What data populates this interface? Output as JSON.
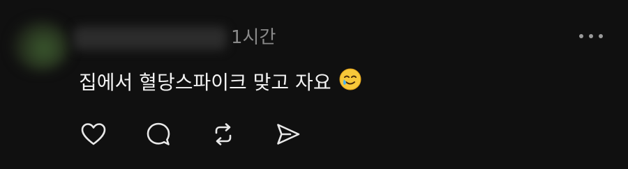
{
  "post": {
    "timestamp": "1시간",
    "text": "집에서 혈당스파이크 맞고 자요",
    "emoji": "smiling-face-with-tear"
  },
  "icons": {
    "more": "more-horizontal-icon",
    "like": "heart-icon",
    "reply": "comment-bubble-icon",
    "repost": "repost-icon",
    "share": "send-icon"
  },
  "colors": {
    "background": "#101010",
    "text": "#f3f3f3",
    "secondary_text": "#8a8a8a"
  }
}
